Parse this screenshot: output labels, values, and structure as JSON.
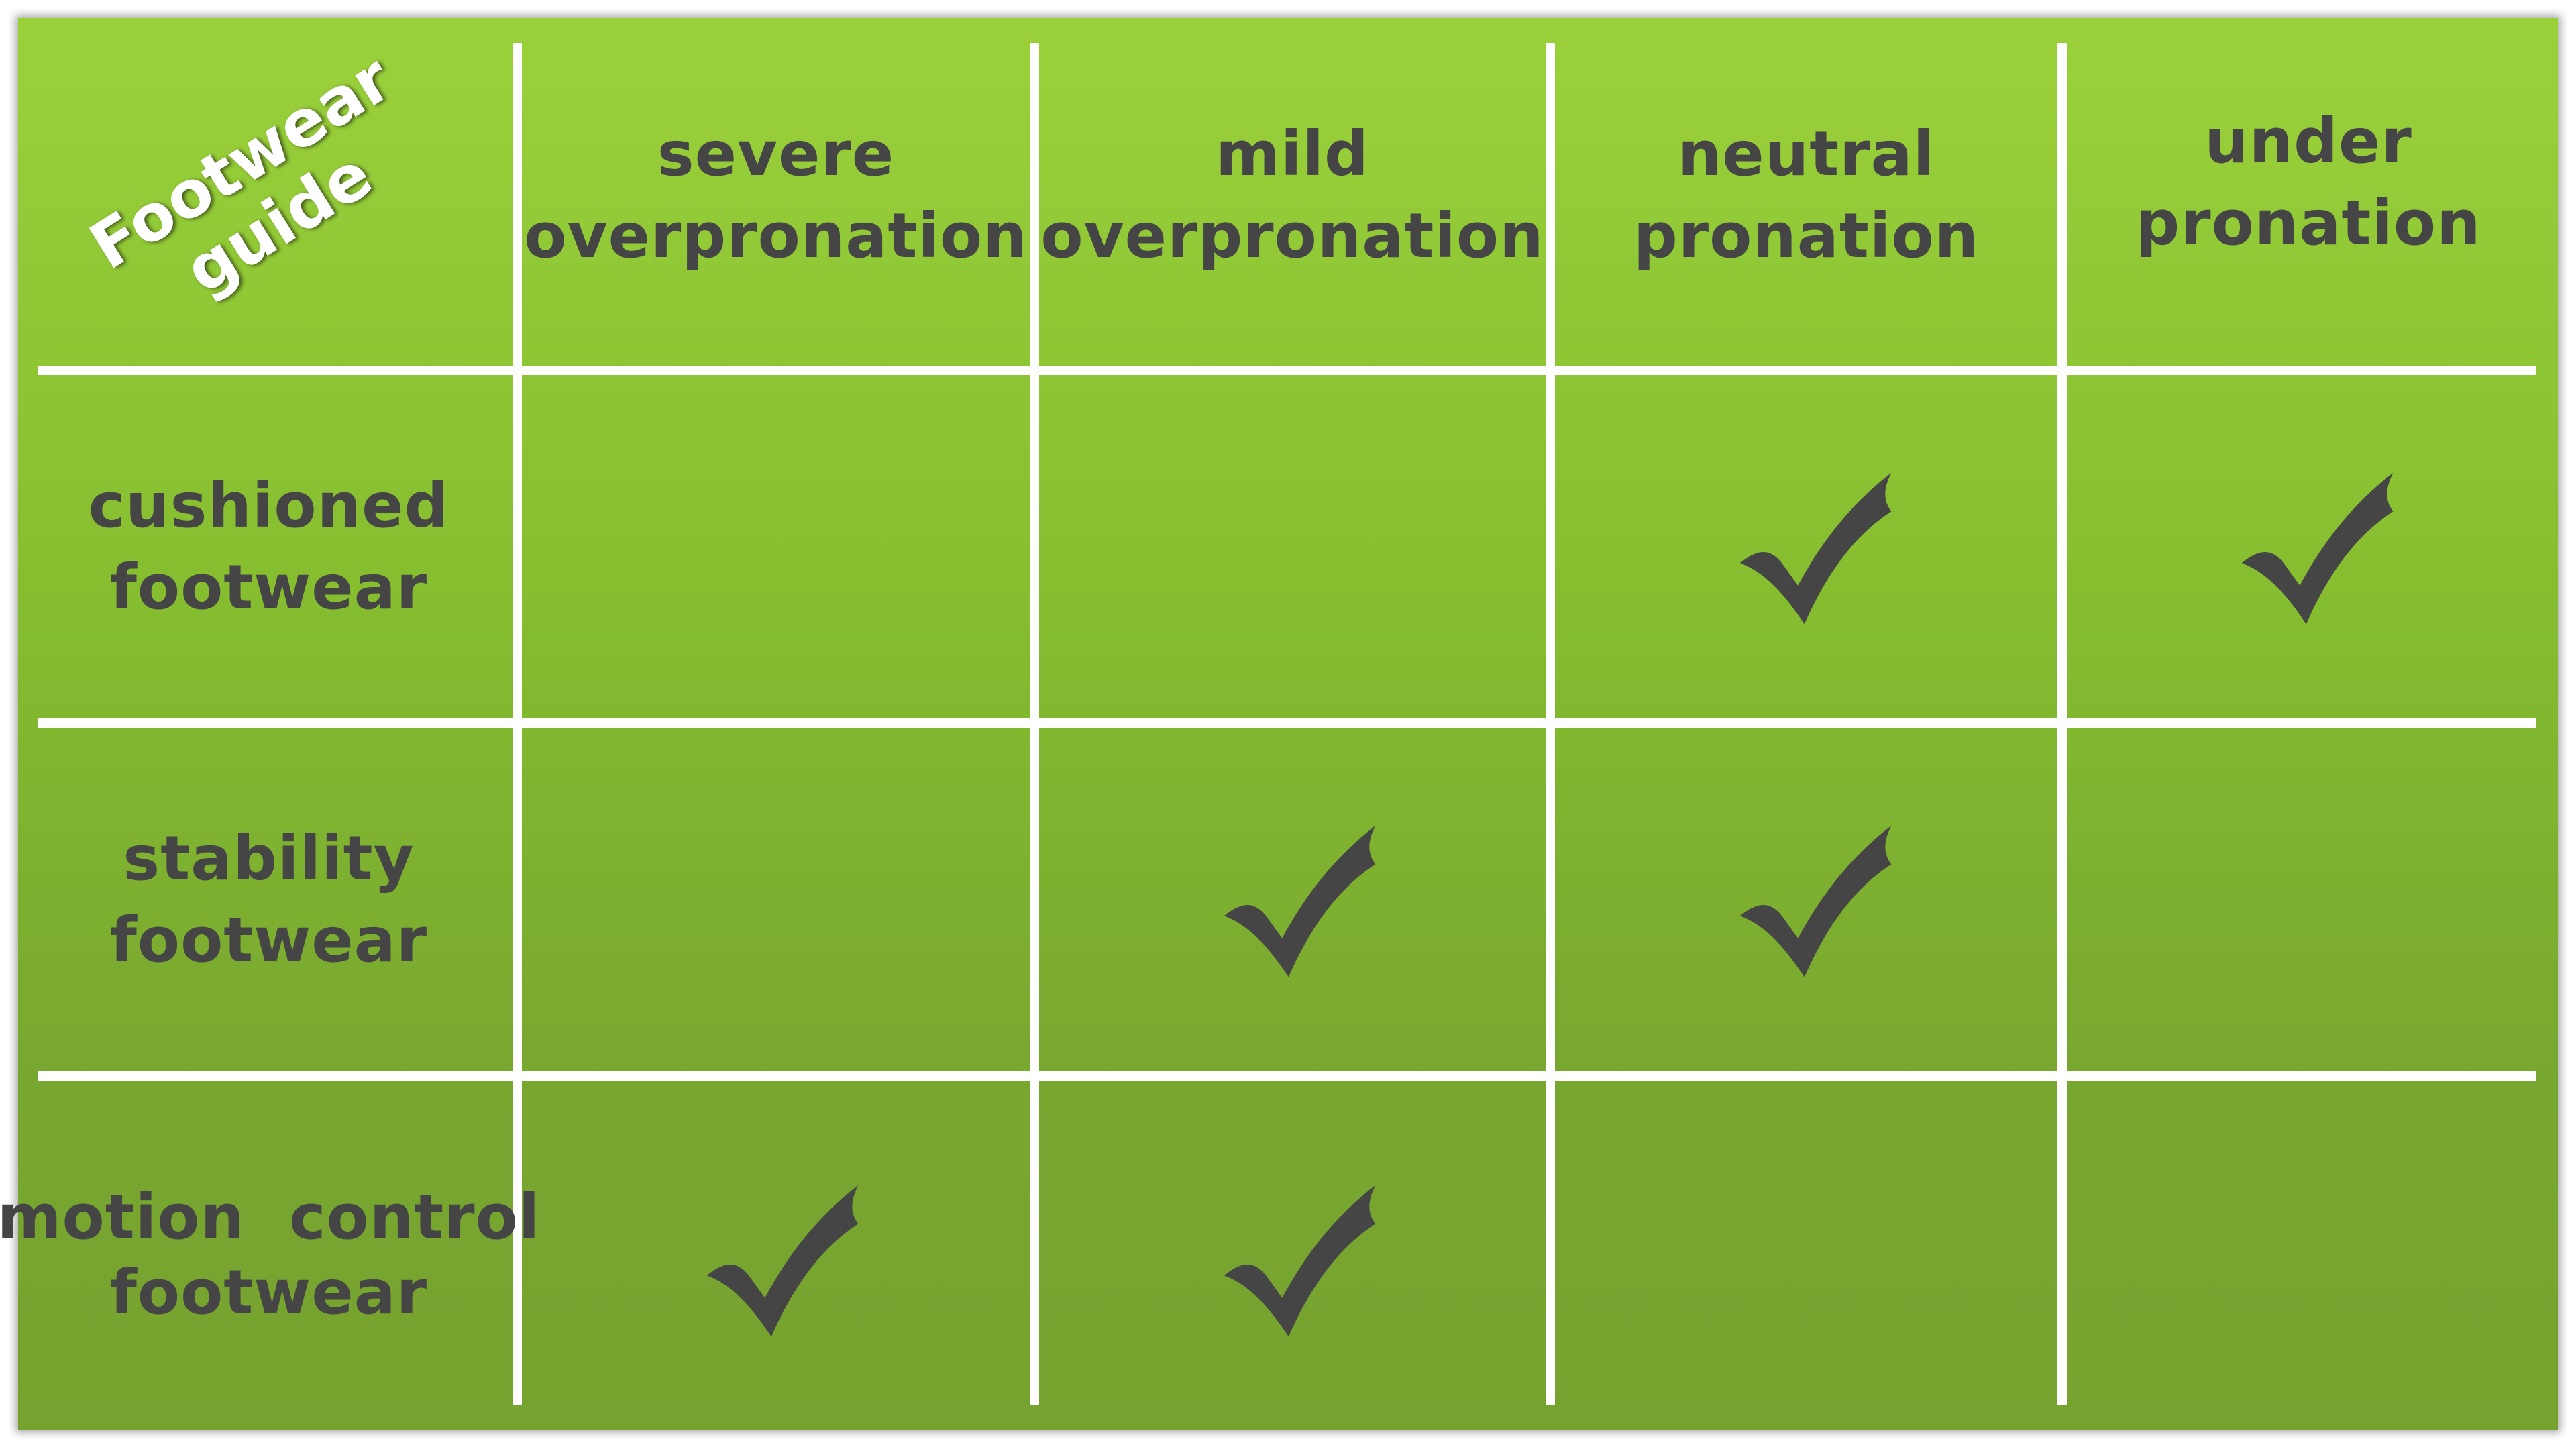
{
  "corner_title": {
    "line1": "Footwear",
    "line2": "guide"
  },
  "columns": [
    {
      "line1": "severe",
      "line2": "overpronation"
    },
    {
      "line1": "mild",
      "line2": "overpronation"
    },
    {
      "line1": "neutral",
      "line2": "pronation"
    },
    {
      "line1": "under",
      "line2": "pronation"
    }
  ],
  "rows": [
    {
      "line1": "cushioned",
      "line2": "footwear",
      "checks": [
        false,
        false,
        true,
        true
      ]
    },
    {
      "line1": "stability",
      "line2": "footwear",
      "checks": [
        false,
        true,
        true,
        false
      ]
    },
    {
      "line1": "motion  control",
      "line2": "footwear",
      "checks": [
        true,
        true,
        false,
        false
      ]
    }
  ],
  "colors": {
    "check": "#454545",
    "text": "#454545",
    "grid": "#ffffff",
    "background_top": "#9ad13b",
    "background_bottom": "#76a32f"
  },
  "icons": {
    "check": "check-icon"
  }
}
